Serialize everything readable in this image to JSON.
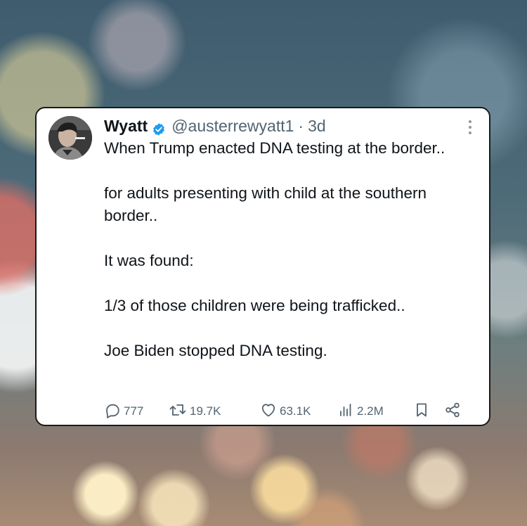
{
  "tweet": {
    "display_name": "Wyatt",
    "handle": "@austerrewyatt1",
    "separator": "·",
    "age": "3d",
    "paragraphs": [
      "When Trump enacted DNA testing at the border..",
      "for adults presenting with child at the southern border..",
      "It was found:",
      "1/3 of those children were being trafficked..",
      "Joe Biden stopped DNA testing."
    ],
    "stats": {
      "replies": "777",
      "reposts": "19.7K",
      "likes": "63.1K",
      "views": "2.2M"
    }
  },
  "colors": {
    "text_primary": "#0f1419",
    "text_secondary": "#536471",
    "verified_badge": "#1d9bf0",
    "card_border": "#1a1a1a"
  },
  "icons": [
    "verified-badge-icon",
    "more-options-icon",
    "reply-icon",
    "repost-icon",
    "like-icon",
    "views-icon",
    "bookmark-icon",
    "share-icon"
  ]
}
